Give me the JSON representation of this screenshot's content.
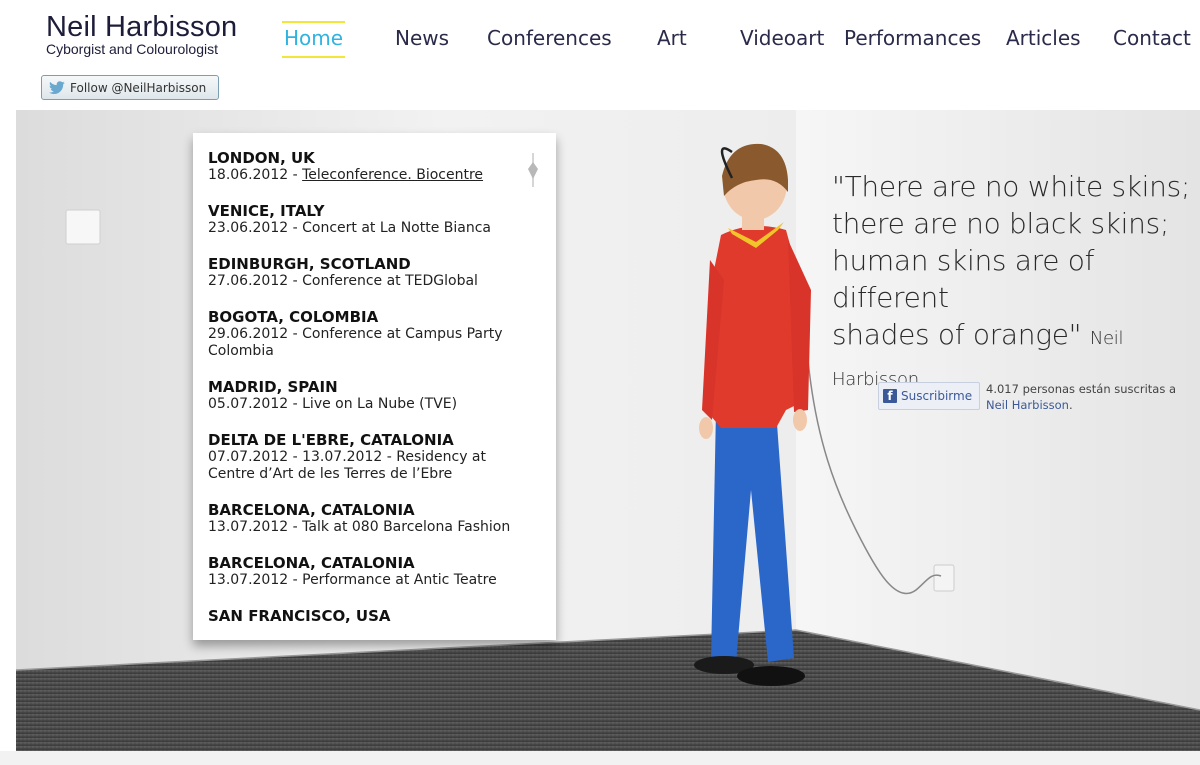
{
  "header": {
    "site_name": "Neil Harbisson",
    "tagline": "Cyborgist and Colourologist"
  },
  "nav": {
    "items": [
      {
        "label": "Home",
        "active": true
      },
      {
        "label": "News"
      },
      {
        "label": "Conferences"
      },
      {
        "label": "Art"
      },
      {
        "label": "Videoart"
      },
      {
        "label": "Performances"
      },
      {
        "label": "Articles"
      },
      {
        "label": "Contact"
      }
    ],
    "active_color": "#2fb3e0",
    "highlight_color": "#f3e53a"
  },
  "twitter": {
    "follow_label": "Follow @NeilHarbisson",
    "icon": "twitter-bird-icon"
  },
  "events": [
    {
      "city": "LONDON, UK",
      "date": "18.06.2012 - ",
      "title": "Teleconference. Biocentre",
      "linked": true
    },
    {
      "city": "VENICE, ITALY",
      "date": "23.06.2012 - ",
      "title": "Concert at La Notte Bianca"
    },
    {
      "city": "EDINBURGH, SCOTLAND",
      "date": "27.06.2012 - ",
      "title": "Conference at TEDGlobal"
    },
    {
      "city": "BOGOTA, COLOMBIA",
      "date": "29.06.2012 - ",
      "title": "Conference at Campus Party Colombia"
    },
    {
      "city": "MADRID, SPAIN",
      "date": "05.07.2012 - ",
      "title": "Live on La Nube (TVE)"
    },
    {
      "city": "DELTA DE L'EBRE, CATALONIA",
      "date": "07.07.2012 - 13.07.2012 - ",
      "title": "Residency at Centre d’Art de les Terres de l’Ebre"
    },
    {
      "city": "BARCELONA, CATALONIA",
      "date": "13.07.2012 - ",
      "title": "Talk at 080 Barcelona Fashion"
    },
    {
      "city": "BARCELONA, CATALONIA",
      "date": "13.07.2012 - ",
      "title": "Performance at Antic Teatre"
    },
    {
      "city": "SAN FRANCISCO, USA",
      "date": "",
      "title": ""
    }
  ],
  "quote": {
    "lines": [
      "\"There are no white skins;",
      "there are no black skins;",
      "human skins are of different",
      "shades of orange\""
    ],
    "author": "Neil Harbisson"
  },
  "facebook": {
    "button_label": "Suscribirme",
    "count_text": "4.017 personas están suscritas a",
    "link_text": "Neil Harbisson",
    "trailing": ".",
    "icon": "facebook-f-icon"
  },
  "colors": {
    "sweater": "#e03a2c",
    "trousers": "#2a67c9",
    "collar": "#f0c52a",
    "floor": "#4a4a4a"
  }
}
